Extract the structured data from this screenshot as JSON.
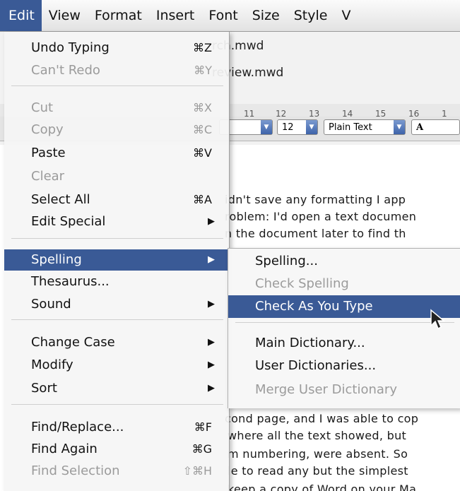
{
  "menubar": {
    "items": [
      "Edit",
      "View",
      "Format",
      "Insert",
      "Font",
      "Size",
      "Style",
      "V"
    ]
  },
  "document": {
    "file1": "rch.mwd",
    "file2": "review.mwd",
    "ruler_labels": [
      "11",
      "12",
      "13",
      "14",
      "15",
      "16",
      "1"
    ],
    "font_size": "12",
    "style": "Plain Text",
    "text_lines": [
      "idn't save any formatting I app",
      "roblem: I'd open a text documen",
      "n the document later to find th",
      "cond page, and I was able to cop",
      "where all the text showed, but",
      "m numbering, were absent. So",
      "le to read any but the simplest",
      "keep a copy of Word on your Ma"
    ]
  },
  "edit_menu": {
    "items": [
      {
        "label": "Undo Typing",
        "shortcut": "⌘Z"
      },
      {
        "label": "Can't Redo",
        "shortcut": "⌘Y"
      },
      {
        "label": "Cut",
        "shortcut": "⌘X"
      },
      {
        "label": "Copy",
        "shortcut": "⌘C"
      },
      {
        "label": "Paste",
        "shortcut": "⌘V"
      },
      {
        "label": "Clear",
        "shortcut": ""
      },
      {
        "label": "Select All",
        "shortcut": "⌘A"
      },
      {
        "label": "Edit Special",
        "shortcut": ""
      },
      {
        "label": "Spelling",
        "shortcut": ""
      },
      {
        "label": "Thesaurus...",
        "shortcut": ""
      },
      {
        "label": "Sound",
        "shortcut": ""
      },
      {
        "label": "Change Case",
        "shortcut": ""
      },
      {
        "label": "Modify",
        "shortcut": ""
      },
      {
        "label": "Sort",
        "shortcut": ""
      },
      {
        "label": "Find/Replace...",
        "shortcut": "⌘F"
      },
      {
        "label": "Find Again",
        "shortcut": "⌘G"
      },
      {
        "label": "Find Selection",
        "shortcut": "⇧⌘H"
      }
    ]
  },
  "spelling_submenu": {
    "items": [
      {
        "label": "Spelling..."
      },
      {
        "label": "Check Spelling"
      },
      {
        "label": "Check As You Type"
      },
      {
        "label": "Main Dictionary..."
      },
      {
        "label": "User Dictionaries..."
      },
      {
        "label": "Merge User Dictionary"
      }
    ]
  },
  "colors": {
    "highlight": "#3a5a96",
    "disabled": "#9b9b9b"
  },
  "icons": {
    "submenu_arrow": "triangle-right-icon",
    "cursor": "arrow-pointer-icon"
  }
}
